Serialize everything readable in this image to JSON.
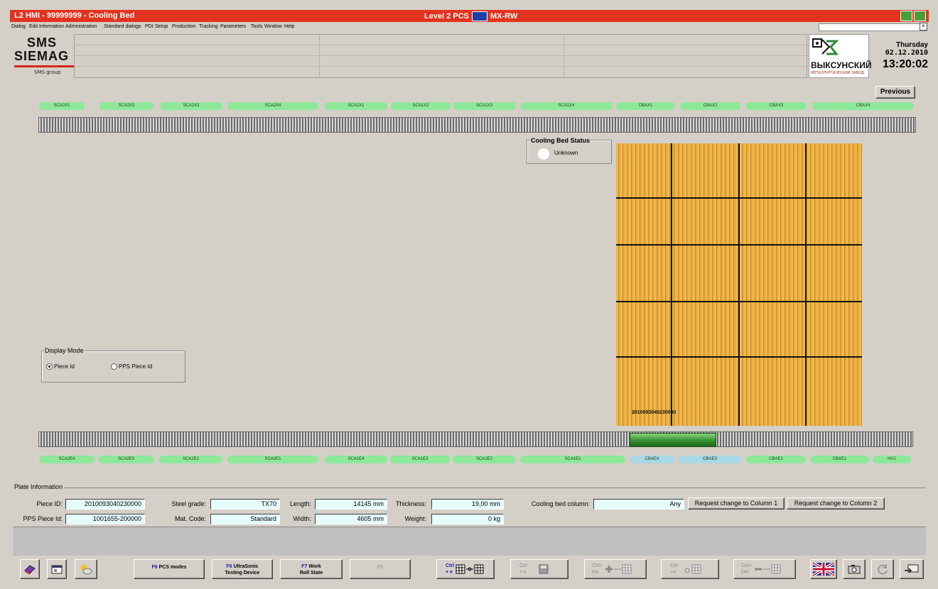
{
  "window": {
    "title": "L2 HMI - 99999999 - Cooling Bed",
    "center_title": "Level 2 PCS",
    "server": "MX-RW"
  },
  "menu": [
    "Dialog",
    "Edit",
    "Information",
    "Administration",
    "Standard dialogs",
    "PDI",
    "Setup",
    "Production",
    "Tracking",
    "Parameters",
    "Tools",
    "Window",
    "Help"
  ],
  "branding": {
    "logo_line1": "SMS",
    "logo_line2": "SIEMAG",
    "logo_sub": "SMS group",
    "plant_name": "ВЫКСУНСКИЙ",
    "plant_sub": "МЕТАЛЛУРГИЧЕСКИЙ ЗАВОД"
  },
  "datetime": {
    "day": "Thursday",
    "date": "02.12.2010",
    "time": "13:20:02"
  },
  "previous_label": "Previous",
  "top_segments": [
    "SCA2X1",
    "SCA2X2",
    "SCA2X3",
    "SCA2X4",
    "SCA1X1",
    "SCA1X2",
    "SCA1X3",
    "SCA1X4",
    "CBAX1",
    "CBAX2",
    "CBAX3",
    "CBAX4"
  ],
  "bottom_segments": [
    "SCA2E4",
    "SCA2E3",
    "SCA2E2",
    "SCA2E1",
    "SCA1E4",
    "SCA1E3",
    "SCA1E2",
    "SCA1E1",
    "CBAE4",
    "CBAE3",
    "CBAE2",
    "CBAE1",
    "HX1"
  ],
  "cooling_bed_status": {
    "title": "Cooling Bed Status",
    "value": "Unknown"
  },
  "bed_piece_label": "2010093040230000",
  "display_mode": {
    "title": "Display Mode",
    "option1": "Piece Id",
    "option2": "PPS Piece Id",
    "selected": "Piece Id"
  },
  "plate_info": {
    "title": "Plate Information",
    "piece_id_label": "Piece ID:",
    "piece_id": "2010093040230000",
    "pps_piece_id_label": "PPS Piece Id:",
    "pps_piece_id": "1001655-200000",
    "steel_grade_label": "Steel grade:",
    "steel_grade": "TX70",
    "mat_code_label": "Mat. Code:",
    "mat_code": "Standard",
    "length_label": "Length:",
    "length": "14145 mm",
    "width_label": "Width:",
    "width": "4605 mm",
    "thickness_label": "Thickness:",
    "thickness": "19,00 mm",
    "weight_label": "Weight:",
    "weight": "0 kg",
    "column_label": "Cooling bed column:",
    "column": "Any",
    "req1": "Request change to Column 1",
    "req2": "Request change to Column 2"
  },
  "toolbar": {
    "f6_key": "F6",
    "f6_label": "PCS modes",
    "f6b_key": "F6",
    "f6b_label1": "UltraSonic",
    "f6b_label2": "Testing Device",
    "f7_key": "F7",
    "f7_label1": "Work",
    "f7_label2": "Roll State",
    "f8_key": "F8",
    "ctrl_e_1": "Ctrl",
    "ctrl_e_2": "+ e",
    "ctrl_s_1": "Ctrl",
    "ctrl_s_2": "+ s",
    "ctrl_ins_1": "Ctrl+",
    "ctrl_ins_2": "Ins",
    "ctrl_d_1": "Ctrl",
    "ctrl_d_2": "+d",
    "ctrl_del_1": "Ctrl+",
    "ctrl_del_2": "Del"
  }
}
